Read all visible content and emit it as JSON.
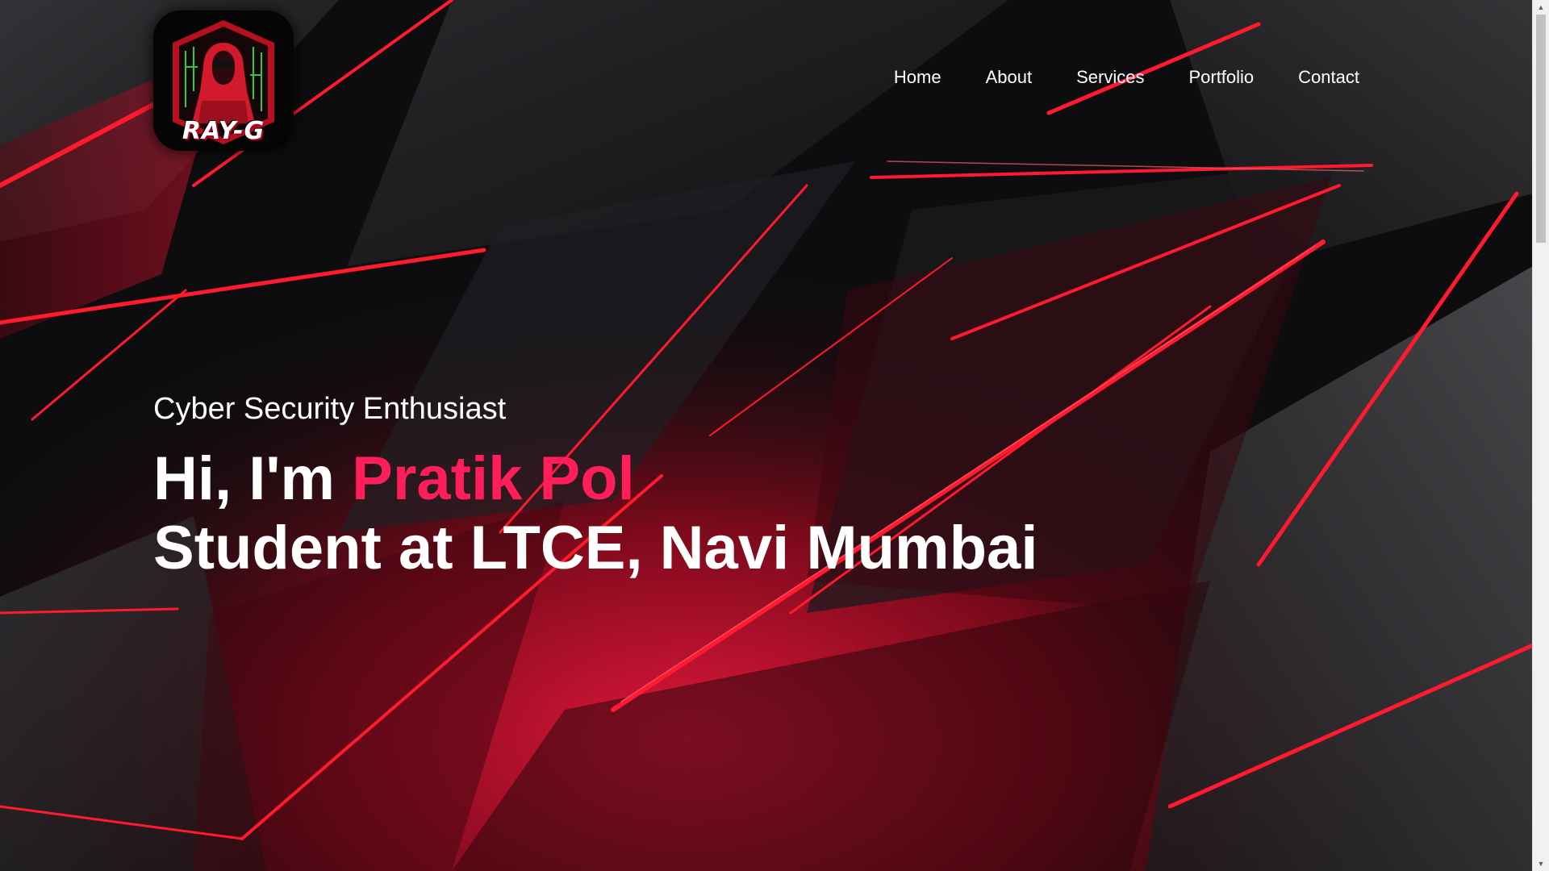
{
  "logo": {
    "text": "RAY-G"
  },
  "nav": {
    "items": [
      "Home",
      "About",
      "Services",
      "Portfolio",
      "Contact"
    ]
  },
  "hero": {
    "tagline": "Cyber Security Enthusiast",
    "greeting": "Hi, I'm",
    "name": "Pratik Pol",
    "subtitle": "Student at LTCE, Navi Mumbai"
  },
  "colors": {
    "accent": "#ff1e5a",
    "background": "#0b0b0d",
    "neon_red": "#ff1a2e",
    "text": "#ffffff"
  },
  "icons": {
    "logo": "hooded-hacker-avatar",
    "scroll_up": "arrow-up-icon",
    "scroll_down": "arrow-down-icon"
  }
}
